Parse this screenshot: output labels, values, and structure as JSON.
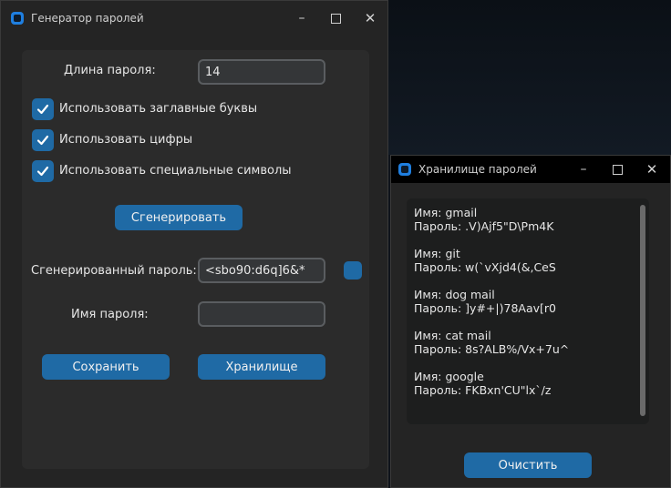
{
  "generator": {
    "title": "Генератор паролей",
    "length_label": "Длина пароля:",
    "length_value": "14",
    "opt_upper_label": "Использовать заглавные буквы",
    "opt_digits_label": "Использовать цифры",
    "opt_special_label": "Использовать специальные символы",
    "generate_label": "Сгенерировать",
    "generated_label": "Сгенерированный пароль:",
    "generated_value": "<sbo90:d6q]6&*",
    "name_label": "Имя пароля:",
    "name_value": "",
    "save_label": "Сохранить",
    "storage_label": "Хранилище",
    "colors": {
      "accent": "#1f6aa5",
      "window": "#242424",
      "frame": "#2b2b2b"
    }
  },
  "storage": {
    "title": "Хранилище паролей",
    "entries": [
      {
        "name": "Имя: gmail",
        "password": "Пароль: .V)Ajf5\"D\\Pm4K"
      },
      {
        "name": "Имя: git",
        "password": "Пароль: w(`vXjd4(&,CeS"
      },
      {
        "name": "Имя: dog mail",
        "password": "Пароль: ]y#+|)78Aav[r0"
      },
      {
        "name": "Имя: cat mail",
        "password": "Пароль: 8s?ALB%/Vx+7u^"
      },
      {
        "name": "Имя: google",
        "password": "Пароль: FKBxn'CU\"lx`/z"
      }
    ],
    "clear_label": "Очистить"
  },
  "icons": [
    "app-icon",
    "minimize-icon",
    "maximize-icon",
    "close-icon",
    "checkmark-icon"
  ]
}
